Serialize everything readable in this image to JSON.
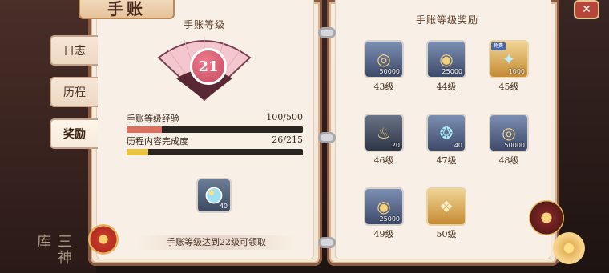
{
  "header": {
    "title": "手账"
  },
  "tabs": [
    {
      "label": "日志",
      "active": false
    },
    {
      "label": "历程",
      "active": false
    },
    {
      "label": "奖励",
      "active": true
    }
  ],
  "left_page": {
    "title": "手账等级",
    "level": "21",
    "stats": [
      {
        "label": "手账等级经验",
        "value": "100/500",
        "progress": 0.2,
        "color": "#d97060"
      },
      {
        "label": "历程内容完成度",
        "value": "26/215",
        "progress": 0.121,
        "color": "#e8c33f"
      }
    ],
    "claim_item_qty": "40",
    "claim_text": "手账等级达到22级可领取"
  },
  "right_page": {
    "title": "手账等级奖励",
    "rewards": [
      {
        "level": "43级",
        "qty": "50000",
        "icon": "coins-icon",
        "gold": false,
        "tag": ""
      },
      {
        "level": "44级",
        "qty": "25000",
        "icon": "swirl-coin-icon",
        "gold": false,
        "tag": ""
      },
      {
        "level": "45级",
        "qty": "1000",
        "icon": "crystal-icon",
        "gold": true,
        "tag": "免费"
      },
      {
        "level": "46级",
        "qty": "20",
        "icon": "lamp-icon",
        "gold": false,
        "tag": ""
      },
      {
        "level": "47级",
        "qty": "40",
        "icon": "gem-icon",
        "gold": false,
        "tag": ""
      },
      {
        "level": "48级",
        "qty": "50000",
        "icon": "coins-icon",
        "gold": false,
        "tag": ""
      },
      {
        "level": "49级",
        "qty": "25000",
        "icon": "swirl-coin-icon",
        "gold": false,
        "tag": ""
      },
      {
        "level": "50级",
        "qty": "",
        "icon": "charm-icon",
        "gold": true,
        "tag": ""
      }
    ]
  },
  "decor": {
    "side_text": "三神库"
  }
}
